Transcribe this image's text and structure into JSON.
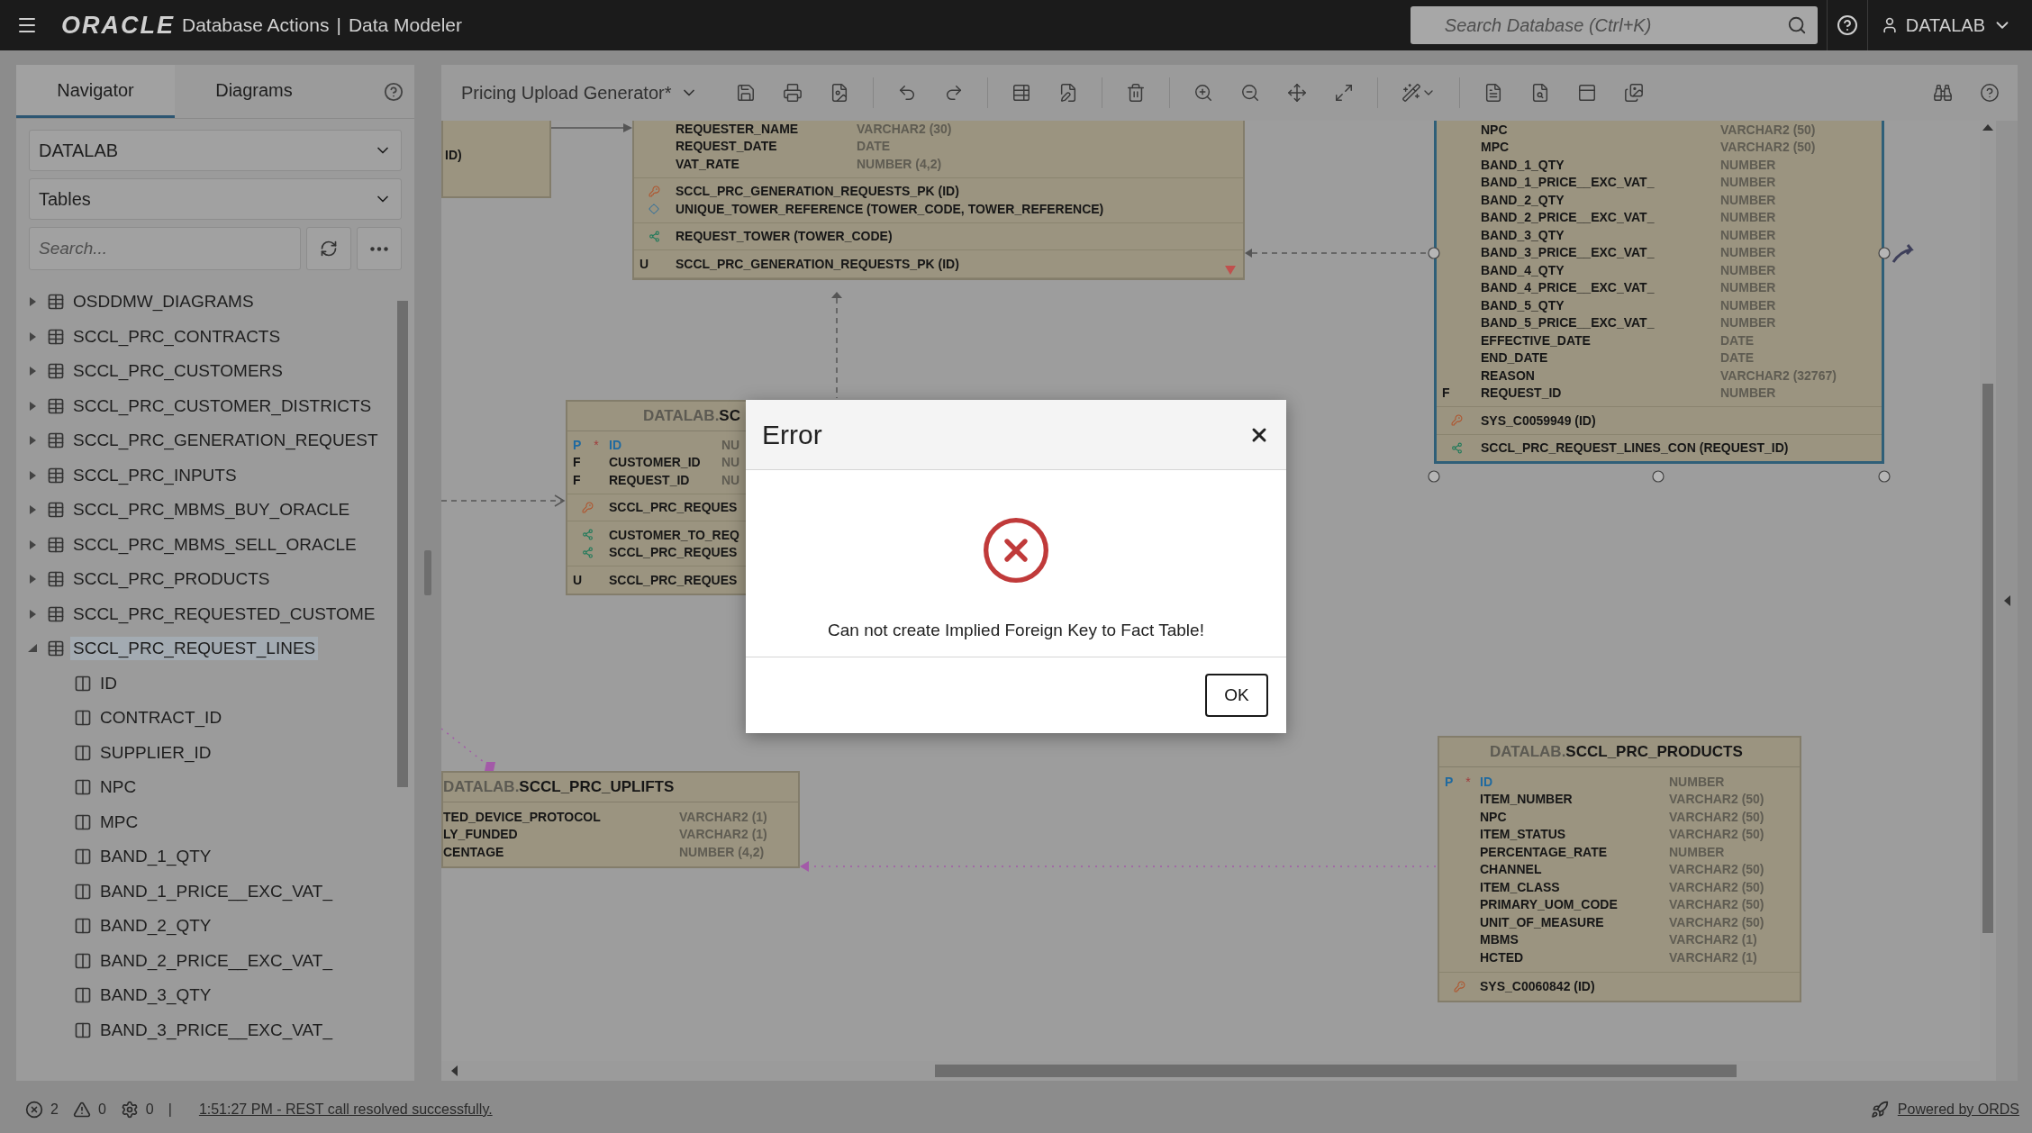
{
  "header": {
    "logo": "ORACLE",
    "product": "Database Actions",
    "separator": "|",
    "app": "Data Modeler",
    "search": {
      "placeholder": "Search Database (Ctrl+K)"
    },
    "user": "DATALAB"
  },
  "navigator": {
    "tabs": [
      {
        "label": "Navigator",
        "selected": true
      },
      {
        "label": "Diagrams",
        "selected": false
      }
    ],
    "schema_select": "DATALAB",
    "type_select": "Tables",
    "search": {
      "placeholder": "Search..."
    },
    "tree": [
      {
        "label": "OSDDMW_DIAGRAMS",
        "expanded": false,
        "selected": false
      },
      {
        "label": "SCCL_PRC_CONTRACTS",
        "expanded": false,
        "selected": false
      },
      {
        "label": "SCCL_PRC_CUSTOMERS",
        "expanded": false,
        "selected": false
      },
      {
        "label": "SCCL_PRC_CUSTOMER_DISTRICTS",
        "expanded": false,
        "selected": false
      },
      {
        "label": "SCCL_PRC_GENERATION_REQUEST",
        "expanded": false,
        "selected": false
      },
      {
        "label": "SCCL_PRC_INPUTS",
        "expanded": false,
        "selected": false
      },
      {
        "label": "SCCL_PRC_MBMS_BUY_ORACLE",
        "expanded": false,
        "selected": false
      },
      {
        "label": "SCCL_PRC_MBMS_SELL_ORACLE",
        "expanded": false,
        "selected": false
      },
      {
        "label": "SCCL_PRC_PRODUCTS",
        "expanded": false,
        "selected": false
      },
      {
        "label": "SCCL_PRC_REQUESTED_CUSTOME",
        "expanded": false,
        "selected": false
      },
      {
        "label": "SCCL_PRC_REQUEST_LINES",
        "expanded": true,
        "selected": true,
        "children": [
          {
            "label": "ID",
            "selected": false
          },
          {
            "label": "CONTRACT_ID",
            "selected": false
          },
          {
            "label": "SUPPLIER_ID",
            "selected": false
          },
          {
            "label": "NPC",
            "selected": false
          },
          {
            "label": "MPC",
            "selected": false
          },
          {
            "label": "BAND_1_QTY",
            "selected": false
          },
          {
            "label": "BAND_1_PRICE__EXC_VAT_",
            "selected": false
          },
          {
            "label": "BAND_2_QTY",
            "selected": false
          },
          {
            "label": "BAND_2_PRICE__EXC_VAT_",
            "selected": false
          },
          {
            "label": "BAND_3_QTY",
            "selected": false
          },
          {
            "label": "BAND_3_PRICE__EXC_VAT_",
            "selected": false
          }
        ]
      }
    ]
  },
  "toolbar": {
    "diagram": "Pricing Upload Generator*"
  },
  "diagram": {
    "tables": [
      {
        "selected": false,
        "sections": [
          {
            "rows": [
              {
                "kind": "index",
                "name": "ID)"
              }
            ]
          }
        ]
      },
      {
        "selected": false,
        "sections": [
          {
            "rows": [
              {
                "kind": "column",
                "name": "REQUESTER_NAME",
                "type": "VARCHAR2 (30)"
              },
              {
                "kind": "column",
                "name": "REQUEST_DATE",
                "type": "DATE"
              },
              {
                "kind": "column",
                "name": "VAT_RATE",
                "type": "NUMBER (4,2)"
              }
            ]
          },
          {
            "rows": [
              {
                "kind": "pk",
                "name": "SCCL_PRC_GENERATION_REQUESTS_PK (ID)"
              },
              {
                "kind": "unique",
                "name": "UNIQUE_TOWER_REFERENCE (TOWER_CODE, TOWER_REFERENCE)"
              }
            ]
          },
          {
            "rows": [
              {
                "kind": "fk",
                "name": "REQUEST_TOWER (TOWER_CODE)"
              }
            ]
          },
          {
            "rows": [
              {
                "kind": "index",
                "flag": "U",
                "name": "SCCL_PRC_GENERATION_REQUESTS_PK (ID)"
              }
            ]
          }
        ]
      },
      {
        "selected": true,
        "sections": [
          {
            "rows": [
              {
                "kind": "column",
                "name": "NPC",
                "type": "VARCHAR2 (50)"
              },
              {
                "kind": "column",
                "name": "MPC",
                "type": "VARCHAR2 (50)"
              },
              {
                "kind": "column",
                "name": "BAND_1_QTY",
                "type": "NUMBER"
              },
              {
                "kind": "column",
                "name": "BAND_1_PRICE__EXC_VAT_",
                "type": "NUMBER"
              },
              {
                "kind": "column",
                "name": "BAND_2_QTY",
                "type": "NUMBER"
              },
              {
                "kind": "column",
                "name": "BAND_2_PRICE__EXC_VAT_",
                "type": "NUMBER"
              },
              {
                "kind": "column",
                "name": "BAND_3_QTY",
                "type": "NUMBER"
              },
              {
                "kind": "column",
                "name": "BAND_3_PRICE__EXC_VAT_",
                "type": "NUMBER"
              },
              {
                "kind": "column",
                "name": "BAND_4_QTY",
                "type": "NUMBER"
              },
              {
                "kind": "column",
                "name": "BAND_4_PRICE__EXC_VAT_",
                "type": "NUMBER"
              },
              {
                "kind": "column",
                "name": "BAND_5_QTY",
                "type": "NUMBER"
              },
              {
                "kind": "column",
                "name": "BAND_5_PRICE__EXC_VAT_",
                "type": "NUMBER"
              },
              {
                "kind": "column",
                "name": "EFFECTIVE_DATE",
                "type": "DATE"
              },
              {
                "kind": "column",
                "name": "END_DATE",
                "type": "DATE"
              },
              {
                "kind": "column",
                "name": "REASON",
                "type": "VARCHAR2 (32767)"
              },
              {
                "kind": "column",
                "flag": "F",
                "name": "REQUEST_ID",
                "type": "NUMBER"
              }
            ]
          },
          {
            "rows": [
              {
                "kind": "pk",
                "name": "SYS_C0059949 (ID)"
              }
            ]
          },
          {
            "rows": [
              {
                "kind": "fk",
                "name": "SCCL_PRC_REQUEST_LINES_CON (REQUEST_ID)"
              }
            ]
          }
        ]
      },
      {
        "selected": false,
        "title": {
          "schema": "DATALAB.",
          "name": "SC"
        },
        "sections": [
          {
            "rows": [
              {
                "kind": "pk_column",
                "flag": "P",
                "star": "*",
                "name": "ID",
                "type": "NU"
              },
              {
                "kind": "column",
                "flag": "F",
                "name": "CUSTOMER_ID",
                "type": "NU"
              },
              {
                "kind": "column",
                "flag": "F",
                "name": "REQUEST_ID",
                "type": "NU"
              }
            ]
          },
          {
            "rows": [
              {
                "kind": "pk",
                "name": "SCCL_PRC_REQUES"
              }
            ]
          },
          {
            "rows": [
              {
                "kind": "fk",
                "name": "CUSTOMER_TO_REQ"
              },
              {
                "kind": "fk",
                "name": "SCCL_PRC_REQUES"
              }
            ]
          },
          {
            "rows": [
              {
                "kind": "index",
                "flag": "U",
                "name": "SCCL_PRC_REQUES"
              }
            ]
          }
        ]
      },
      {
        "selected": false,
        "title": {
          "schema": "DATALAB.",
          "name": "SCCL_PRC_UPLIFTS"
        },
        "sections": [
          {
            "rows": [
              {
                "kind": "column",
                "name": "TED_DEVICE_PROTOCOL",
                "type": "VARCHAR2 (1)"
              },
              {
                "kind": "column",
                "name": "LY_FUNDED",
                "type": "VARCHAR2 (1)"
              },
              {
                "kind": "column",
                "name": "CENTAGE",
                "type": "NUMBER (4,2)"
              }
            ]
          }
        ]
      },
      {
        "selected": false,
        "title": {
          "schema": "DATALAB.",
          "name": "SCCL_PRC_PRODUCTS"
        },
        "sections": [
          {
            "rows": [
              {
                "kind": "pk_column",
                "flag": "P",
                "star": "*",
                "name": "ID",
                "type": "NUMBER"
              },
              {
                "kind": "column",
                "name": "ITEM_NUMBER",
                "type": "VARCHAR2 (50)"
              },
              {
                "kind": "column",
                "name": "NPC",
                "type": "VARCHAR2 (50)"
              },
              {
                "kind": "column",
                "name": "ITEM_STATUS",
                "type": "VARCHAR2 (50)"
              },
              {
                "kind": "column",
                "name": "PERCENTAGE_RATE",
                "type": "NUMBER"
              },
              {
                "kind": "column",
                "name": "CHANNEL",
                "type": "VARCHAR2 (50)"
              },
              {
                "kind": "column",
                "name": "ITEM_CLASS",
                "type": "VARCHAR2 (50)"
              },
              {
                "kind": "column",
                "name": "PRIMARY_UOM_CODE",
                "type": "VARCHAR2 (50)"
              },
              {
                "kind": "column",
                "name": "UNIT_OF_MEASURE",
                "type": "VARCHAR2 (50)"
              },
              {
                "kind": "column",
                "name": "MBMS",
                "type": "VARCHAR2 (1)"
              },
              {
                "kind": "column",
                "name": "HCTED",
                "type": "VARCHAR2 (1)"
              }
            ]
          },
          {
            "rows": [
              {
                "kind": "pk",
                "name": "SYS_C0060842 (ID)"
              }
            ]
          }
        ]
      }
    ]
  },
  "dialog": {
    "title": "Error",
    "message": "Can not create Implied Foreign Key to Fact Table!",
    "button": "OK"
  },
  "status_bar": {
    "errors": "2",
    "warnings": "0",
    "settings": "0",
    "separator": "|",
    "message": "1:51:27 PM - REST call resolved successfully.",
    "powered": "Powered by ORDS"
  }
}
